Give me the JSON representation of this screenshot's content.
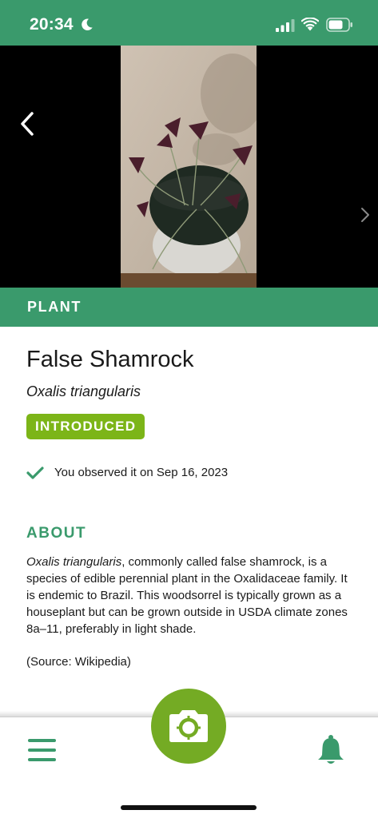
{
  "status_bar": {
    "time": "20:34",
    "icons": [
      "moon-icon",
      "signal-icon",
      "wifi-icon",
      "battery-icon"
    ]
  },
  "photo": {
    "icons": [
      "back-arrow-icon",
      "chevron-right-icon"
    ]
  },
  "category": {
    "label": "PLANT"
  },
  "species": {
    "common_name": "False Shamrock",
    "scientific_name": "Oxalis triangularis",
    "status_badge": "INTRODUCED",
    "observation_text": "You observed it on Sep 16, 2023"
  },
  "about": {
    "heading": "ABOUT",
    "sci_term": "Oxalis triangularis",
    "text": ", commonly called false shamrock, is a species of edible perennial plant in the Oxalidaceae family. It is endemic to Brazil. This woodsorrel is typically grown as a houseplant but can be grown outside in USDA climate zones 8a–11, preferably in light shade.",
    "source": "(Source: Wikipedia)"
  },
  "tabbar": {
    "icons": [
      "menu-icon",
      "camera-icon",
      "bell-icon"
    ]
  },
  "colors": {
    "brand_green": "#3a9a6c",
    "badge_green": "#7cb518",
    "camera_green": "#74ab24"
  }
}
